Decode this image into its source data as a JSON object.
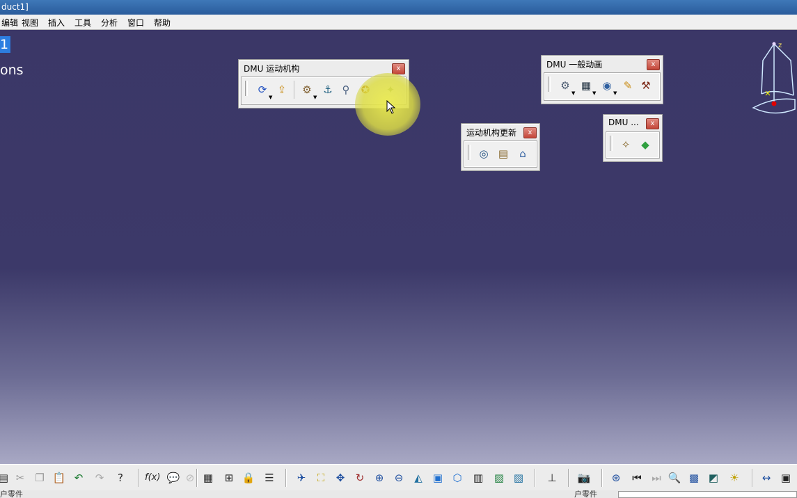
{
  "window": {
    "title": "duct1]"
  },
  "menu": [
    "编辑",
    "视图",
    "插入",
    "工具",
    "分析",
    "窗口",
    "帮助"
  ],
  "tree": {
    "selected": "1",
    "label": "ons"
  },
  "toolbars": {
    "kinematics": {
      "title": "DMU 运动机构",
      "close": "x"
    },
    "generic_animation": {
      "title": "DMU 一般动画",
      "close": "x"
    },
    "update": {
      "title": "运动机构更新",
      "close": "x"
    },
    "small": {
      "title": "DMU ...",
      "close": "x"
    }
  },
  "compass": {
    "z_label": "z"
  },
  "status": {
    "left": "户零件",
    "right": "户零件"
  },
  "bottom_toolbar": {
    "formula_label": "f(x)"
  },
  "colors": {
    "canvas_top": "#3b3767",
    "canvas_bottom": "#a8a8c4",
    "highlight": "#e8e850",
    "selection": "#2d7ee0"
  }
}
